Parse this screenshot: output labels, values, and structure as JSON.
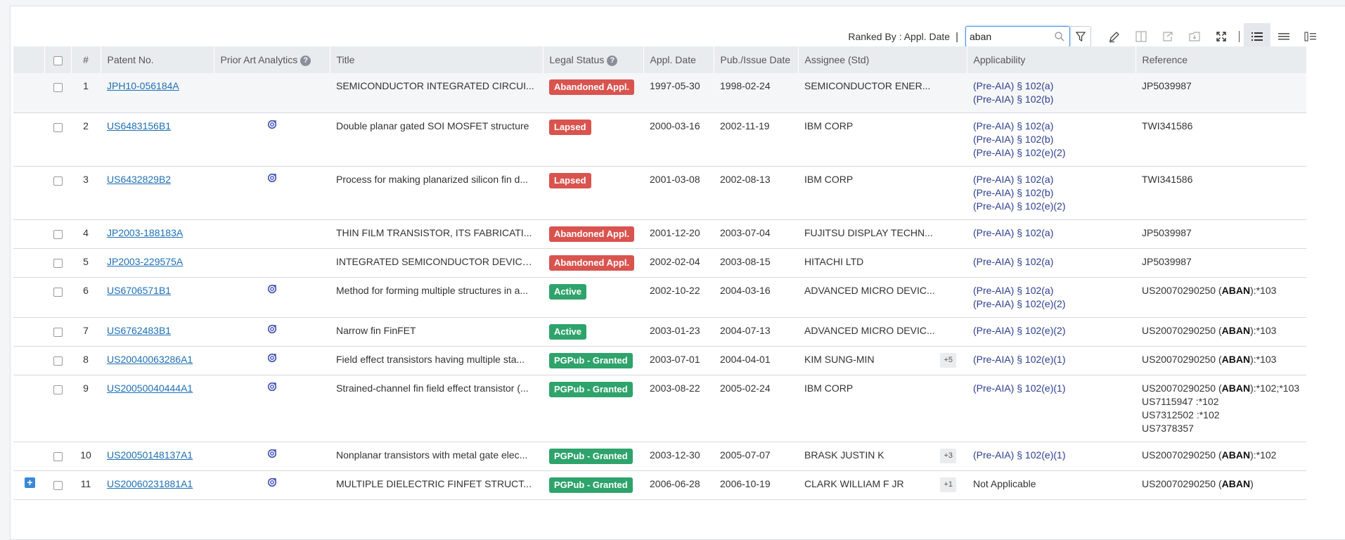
{
  "toolbar": {
    "ranked_by": "Ranked By : Appl. Date",
    "separator": "|",
    "search_value": "aban"
  },
  "columns": {
    "num": "#",
    "patent_no": "Patent No.",
    "prior_art": "Prior Art Analytics",
    "title": "Title",
    "legal_status": "Legal Status",
    "appl_date": "Appl. Date",
    "pub_date": "Pub./Issue Date",
    "assignee": "Assignee (Std)",
    "applicability": "Applicability",
    "reference": "Reference"
  },
  "rows": [
    {
      "num": "1",
      "patent": "JPH10-056184A",
      "prior_art": false,
      "title": "SEMICONDUCTOR INTEGRATED CIRCUI...",
      "status": "Abandoned Appl.",
      "status_type": "aban",
      "appl": "1997-05-30",
      "pub": "1998-02-24",
      "assignee": "SEMICONDUCTOR ENER...",
      "plus": "",
      "applicability": [
        "(Pre-AIA) § 102(a)",
        "(Pre-AIA) § 102(b)"
      ],
      "reference": [
        {
          "pre": "JP5039987",
          "bold": "",
          "post": ""
        }
      ]
    },
    {
      "num": "2",
      "patent": "US6483156B1",
      "prior_art": true,
      "title": "Double planar gated SOI MOSFET structure",
      "status": "Lapsed",
      "status_type": "lapsed",
      "appl": "2000-03-16",
      "pub": "2002-11-19",
      "assignee": "IBM CORP",
      "plus": "",
      "applicability": [
        "(Pre-AIA) § 102(a)",
        "(Pre-AIA) § 102(b)",
        "(Pre-AIA) § 102(e)(2)"
      ],
      "reference": [
        {
          "pre": "TWI341586",
          "bold": "",
          "post": ""
        }
      ]
    },
    {
      "num": "3",
      "patent": "US6432829B2",
      "prior_art": true,
      "title": "Process for making planarized silicon fin d...",
      "status": "Lapsed",
      "status_type": "lapsed",
      "appl": "2001-03-08",
      "pub": "2002-08-13",
      "assignee": "IBM CORP",
      "plus": "",
      "applicability": [
        "(Pre-AIA) § 102(a)",
        "(Pre-AIA) § 102(b)",
        "(Pre-AIA) § 102(e)(2)"
      ],
      "reference": [
        {
          "pre": "TWI341586",
          "bold": "",
          "post": ""
        }
      ]
    },
    {
      "num": "4",
      "patent": "JP2003-188183A",
      "prior_art": false,
      "title": "THIN FILM TRANSISTOR, ITS FABRICATI...",
      "status": "Abandoned Appl.",
      "status_type": "aban",
      "appl": "2001-12-20",
      "pub": "2003-07-04",
      "assignee": "FUJITSU DISPLAY TECHN...",
      "plus": "",
      "applicability": [
        "(Pre-AIA) § 102(a)"
      ],
      "reference": [
        {
          "pre": "JP5039987",
          "bold": "",
          "post": ""
        }
      ]
    },
    {
      "num": "5",
      "patent": "JP2003-229575A",
      "prior_art": false,
      "title": "INTEGRATED SEMICONDUCTOR DEVICE...",
      "status": "Abandoned Appl.",
      "status_type": "aban",
      "appl": "2002-02-04",
      "pub": "2003-08-15",
      "assignee": "HITACHI LTD",
      "plus": "",
      "applicability": [
        "(Pre-AIA) § 102(a)"
      ],
      "reference": [
        {
          "pre": "JP5039987",
          "bold": "",
          "post": ""
        }
      ]
    },
    {
      "num": "6",
      "patent": "US6706571B1",
      "prior_art": true,
      "title": "Method for forming multiple structures in a...",
      "status": "Active",
      "status_type": "active",
      "appl": "2002-10-22",
      "pub": "2004-03-16",
      "assignee": "ADVANCED MICRO DEVIC...",
      "plus": "",
      "applicability": [
        "(Pre-AIA) § 102(a)",
        "(Pre-AIA) § 102(e)(2)"
      ],
      "reference": [
        {
          "pre": "US20070290250 (",
          "bold": "ABAN",
          "post": "):*103"
        }
      ]
    },
    {
      "num": "7",
      "patent": "US6762483B1",
      "prior_art": true,
      "title": "Narrow fin FinFET",
      "status": "Active",
      "status_type": "active",
      "appl": "2003-01-23",
      "pub": "2004-07-13",
      "assignee": "ADVANCED MICRO DEVIC...",
      "plus": "",
      "applicability": [
        "(Pre-AIA) § 102(e)(2)"
      ],
      "reference": [
        {
          "pre": "US20070290250 (",
          "bold": "ABAN",
          "post": "):*103"
        }
      ]
    },
    {
      "num": "8",
      "patent": "US20040063286A1",
      "prior_art": true,
      "title": "Field effect transistors having multiple sta...",
      "status": "PGPub - Granted",
      "status_type": "pgpub",
      "appl": "2003-07-01",
      "pub": "2004-04-01",
      "assignee": "KIM SUNG-MIN",
      "plus": "+5",
      "applicability": [
        "(Pre-AIA) § 102(e)(1)"
      ],
      "reference": [
        {
          "pre": "US20070290250 (",
          "bold": "ABAN",
          "post": "):*103"
        }
      ]
    },
    {
      "num": "9",
      "patent": "US20050040444A1",
      "prior_art": true,
      "title": "Strained-channel fin field effect transistor (...",
      "status": "PGPub - Granted",
      "status_type": "pgpub",
      "appl": "2003-08-22",
      "pub": "2005-02-24",
      "assignee": "IBM CORP",
      "plus": "",
      "applicability": [
        "(Pre-AIA) § 102(e)(1)"
      ],
      "reference": [
        {
          "pre": "US20070290250 (",
          "bold": "ABAN",
          "post": "):*102;*103"
        },
        {
          "pre": "US7115947 :*102",
          "bold": "",
          "post": ""
        },
        {
          "pre": "US7312502 :*102",
          "bold": "",
          "post": ""
        },
        {
          "pre": "US7378357",
          "bold": "",
          "post": ""
        }
      ]
    },
    {
      "num": "10",
      "patent": "US20050148137A1",
      "prior_art": true,
      "title": "Nonplanar transistors with metal gate elec...",
      "status": "PGPub - Granted",
      "status_type": "pgpub",
      "appl": "2003-12-30",
      "pub": "2005-07-07",
      "assignee": "BRASK JUSTIN K",
      "plus": "+3",
      "applicability": [
        "(Pre-AIA) § 102(e)(1)"
      ],
      "reference": [
        {
          "pre": "US20070290250 (",
          "bold": "ABAN",
          "post": "):*102"
        }
      ]
    },
    {
      "num": "11",
      "patent": "US20060231881A1",
      "prior_art": true,
      "title": "MULTIPLE DIELECTRIC FINFET STRUCT...",
      "status": "PGPub - Granted",
      "status_type": "pgpub",
      "appl": "2006-06-28",
      "pub": "2006-10-19",
      "assignee": "CLARK WILLIAM F JR",
      "plus": "+1",
      "applicability_text": "Not Applicable",
      "applicability": [],
      "reference": [
        {
          "pre": "US20070290250 (",
          "bold": "ABAN",
          "post": ")"
        }
      ],
      "expand": "+"
    }
  ],
  "colors": {
    "accent": "#1e6fb5",
    "red": "#d9534f",
    "green": "#2ea36b"
  }
}
